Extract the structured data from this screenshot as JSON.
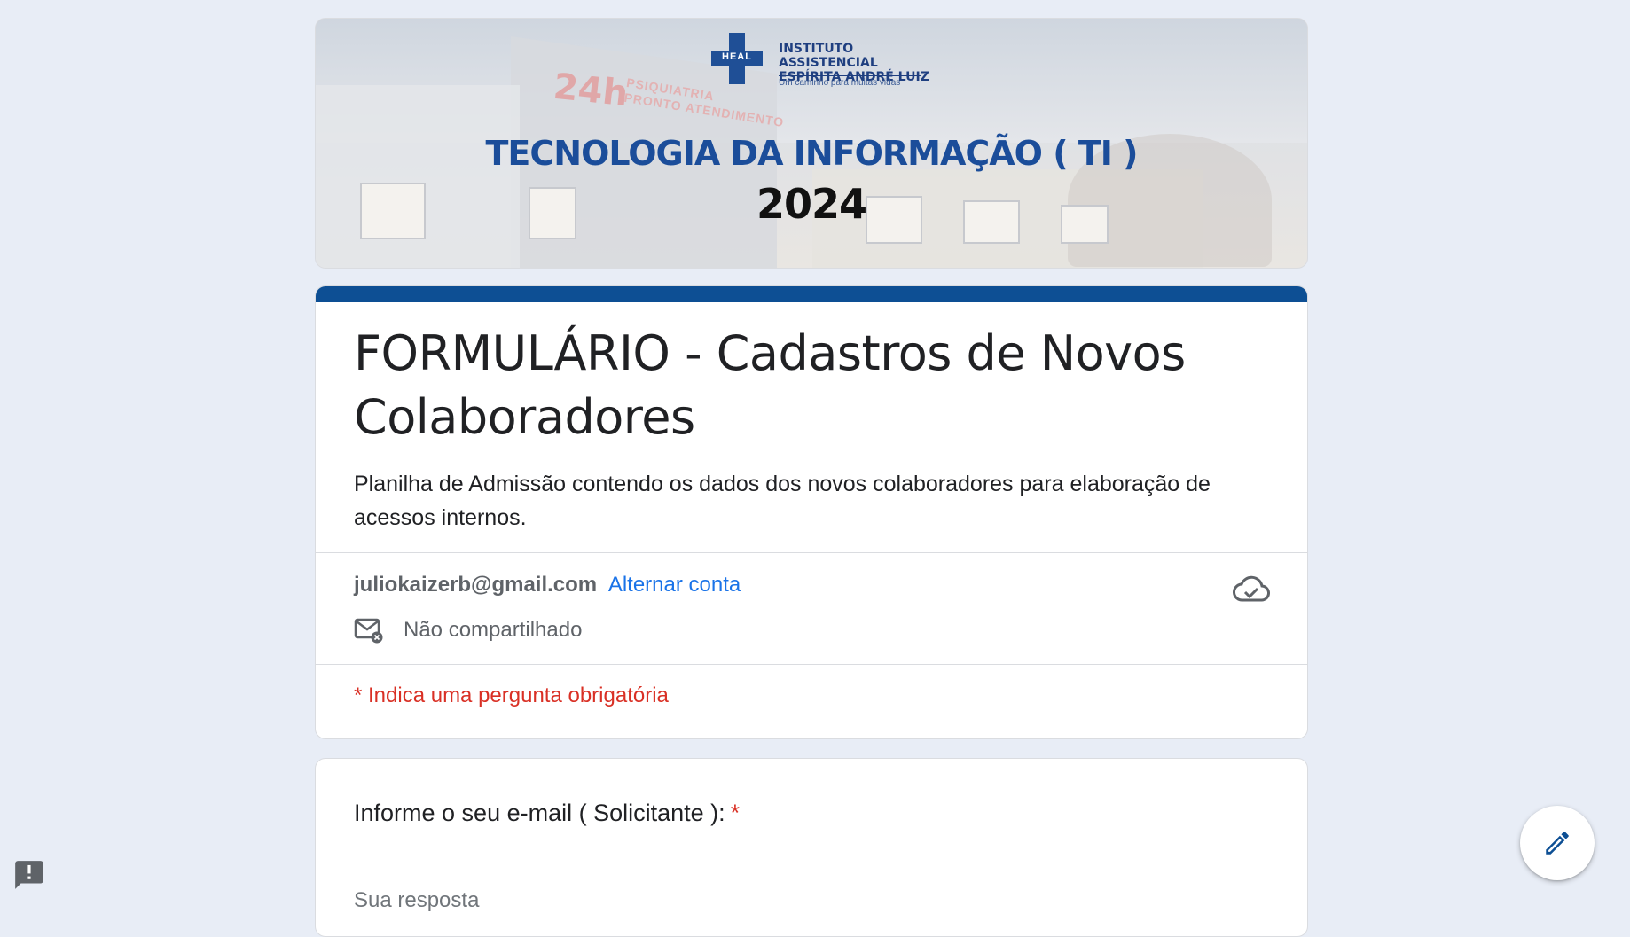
{
  "banner": {
    "logo_line1": "INSTITUTO ASSISTENCIAL",
    "logo_line2": "ESPÍRITA ANDRÉ LUIZ",
    "logo_tagline": "Um caminho para muitas vidas",
    "logo_badge": "HEAL",
    "sign_24h": "24h",
    "sign_line1": "PSIQUIATRIA",
    "sign_line2": "PRONTO ATENDIMENTO",
    "title": "TECNOLOGIA DA INFORMAÇÃO ( TI )",
    "year": "2024"
  },
  "form": {
    "title": "FORMULÁRIO - Cadastros de Novos Colaboradores",
    "description": "Planilha de Admissão contendo os dados dos novos colaboradores para elaboração de acessos internos.",
    "account_email": "juliokaizerb@gmail.com",
    "switch_account": "Alternar conta",
    "not_shared": "Não compartilhado",
    "required_note": "* Indica uma pergunta obrigatória",
    "accent_color": "#0d4f94"
  },
  "question": {
    "label": "Informe o seu e-mail ( Solicitante ):",
    "required_mark": "*",
    "placeholder": "Sua resposta"
  },
  "icons": {
    "cloud": "cloud-check-icon",
    "mail": "mail-not-shared-icon",
    "edit": "pencil-icon",
    "feedback": "feedback-icon"
  }
}
